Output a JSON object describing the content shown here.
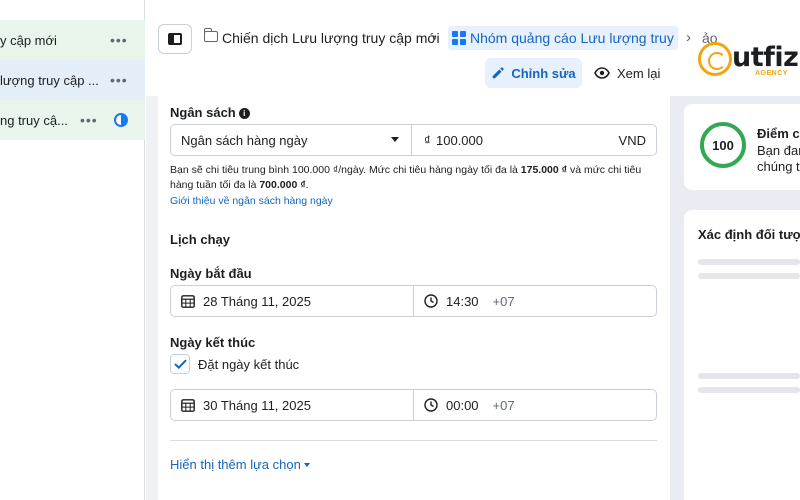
{
  "tree": {
    "rows": [
      {
        "label": "y cập mới",
        "more": "•••"
      },
      {
        "label": "lượng truy cập ...",
        "more": "•••"
      },
      {
        "label": "ng truy cậ...",
        "more": "•••"
      }
    ]
  },
  "topbar": {
    "breadcrumb": {
      "campaign": "Chiến dịch Lưu lượng truy cập mới",
      "adset": "Nhóm quảng cáo Lưu lượng truy cập mới",
      "ad_partial": "ảo"
    },
    "edit_label": "Chỉnh sửa",
    "view_label": "Xem lại"
  },
  "logo": {
    "main": "utfiz",
    "sub": "AGENCY"
  },
  "budget": {
    "label": "Ngân sách",
    "type": "Ngân sách hàng ngày",
    "currency_symbol": "₫",
    "amount": "100.000",
    "currency": "VND",
    "help_p1": "Bạn sẽ chi tiêu trung bình 100.000 ₫/ngày. Mức chi tiêu hàng ngày tối đa là ",
    "help_b1": "175.000 ₫",
    "help_p2": " và mức chi tiêu hàng tuần tối đa là ",
    "help_b2": "700.000 ₫",
    "help_p3": ".",
    "link": "Giới thiệu về ngân sách hàng ngày"
  },
  "schedule": {
    "title": "Lịch chạy",
    "start_label": "Ngày bắt đầu",
    "start_date": "28 Tháng 11, 2025",
    "start_time": "14:30",
    "start_tz": "+07",
    "end_label": "Ngày kết thúc",
    "end_checkbox_label": "Đặt ngày kết thúc",
    "end_checked": true,
    "end_date": "30 Tháng 11, 2025",
    "end_time": "00:00",
    "end_tz": "+07"
  },
  "more_options": "Hiển thị thêm lựa chọn",
  "right": {
    "score": "100",
    "score_title": "Điểm c",
    "score_line1": "Bạn đan",
    "score_line2": "chúng t",
    "audience_title": "Xác định đối tượ"
  },
  "colors": {
    "accent": "#1877f2",
    "link": "#1565c0",
    "score_ring": "#32a852",
    "logo_orange": "#f3a40f"
  }
}
